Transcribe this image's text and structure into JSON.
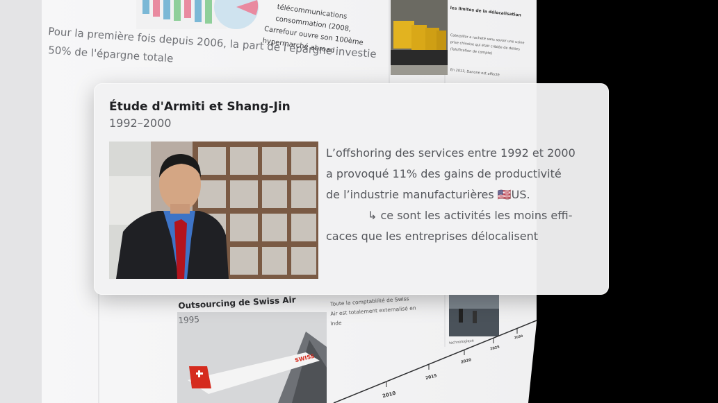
{
  "background": {
    "headline_line1": "Pour la première fois depuis 2006, la part de l'épargne investie",
    "headline_line2": "50% de l'épargne totale",
    "bullets": [
      "télécommunications",
      "consommation (2008,",
      "Carrefour ouvre son 100ème",
      "hypermarché abroad"
    ],
    "right_heading": "les limites de la délocalisation",
    "right_text_1": "Caterpillar a racheté sans savoir une usine",
    "right_text_2": "prise chinoise qui était criblée de dettes",
    "right_text_3": "(falsification de compte)",
    "right_text_4": "En 2013, Danone est affecté",
    "swiss_title": "Outsourcing de Swiss Air",
    "swiss_year": "1995",
    "swiss_desc_1": "Toute la comptabilité de Swiss",
    "swiss_desc_2": "Air est totalement externalisé en",
    "swiss_desc_3": "Inde",
    "tech_label": "technologique",
    "timeline_years": [
      "2010",
      "2015",
      "2020",
      "2025",
      "2030"
    ],
    "plane_brand": "SWISS"
  },
  "card": {
    "title": "Étude d'Armiti et Shang-Jin",
    "years": "1992–2000",
    "body_line1": "L’offshoring des services entre 1992 et 2000",
    "body_line2": "a provoqué 11% des gains de productivité",
    "body_line3_text": "de l’industrie manufacturières ",
    "body_line3_flag": "🇺🇸",
    "body_line3_end": "US.",
    "body_line4": "↳ ce sont les activités les moins effi-",
    "body_line5": "caces que les entreprises délocalisent"
  },
  "colors": {
    "page_bg": "#f4f4f5",
    "card_bg": "#f1f1f3",
    "title": "#1e1f22",
    "body_text": "#55575c"
  }
}
